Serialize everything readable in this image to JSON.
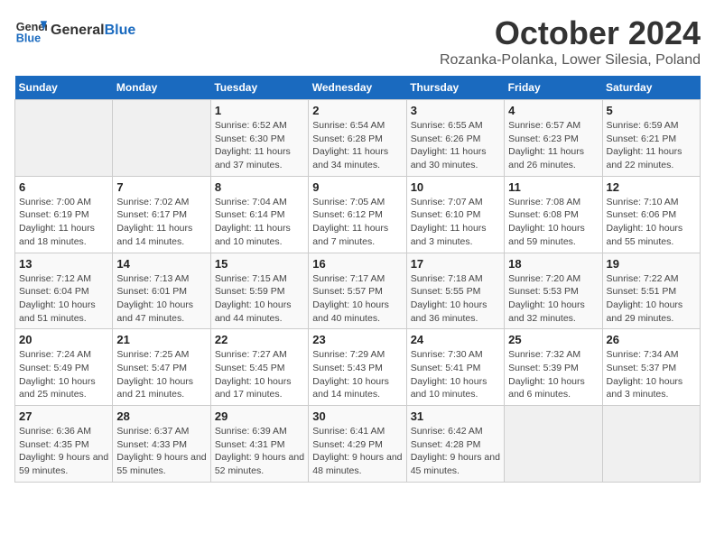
{
  "header": {
    "logo_line1": "General",
    "logo_line2": "Blue",
    "month": "October 2024",
    "location": "Rozanka-Polanka, Lower Silesia, Poland"
  },
  "weekdays": [
    "Sunday",
    "Monday",
    "Tuesday",
    "Wednesday",
    "Thursday",
    "Friday",
    "Saturday"
  ],
  "weeks": [
    [
      null,
      null,
      {
        "day": 1,
        "sunrise": "6:52 AM",
        "sunset": "6:30 PM",
        "daylight": "11 hours and 37 minutes."
      },
      {
        "day": 2,
        "sunrise": "6:54 AM",
        "sunset": "6:28 PM",
        "daylight": "11 hours and 34 minutes."
      },
      {
        "day": 3,
        "sunrise": "6:55 AM",
        "sunset": "6:26 PM",
        "daylight": "11 hours and 30 minutes."
      },
      {
        "day": 4,
        "sunrise": "6:57 AM",
        "sunset": "6:23 PM",
        "daylight": "11 hours and 26 minutes."
      },
      {
        "day": 5,
        "sunrise": "6:59 AM",
        "sunset": "6:21 PM",
        "daylight": "11 hours and 22 minutes."
      }
    ],
    [
      {
        "day": 6,
        "sunrise": "7:00 AM",
        "sunset": "6:19 PM",
        "daylight": "11 hours and 18 minutes."
      },
      {
        "day": 7,
        "sunrise": "7:02 AM",
        "sunset": "6:17 PM",
        "daylight": "11 hours and 14 minutes."
      },
      {
        "day": 8,
        "sunrise": "7:04 AM",
        "sunset": "6:14 PM",
        "daylight": "11 hours and 10 minutes."
      },
      {
        "day": 9,
        "sunrise": "7:05 AM",
        "sunset": "6:12 PM",
        "daylight": "11 hours and 7 minutes."
      },
      {
        "day": 10,
        "sunrise": "7:07 AM",
        "sunset": "6:10 PM",
        "daylight": "11 hours and 3 minutes."
      },
      {
        "day": 11,
        "sunrise": "7:08 AM",
        "sunset": "6:08 PM",
        "daylight": "10 hours and 59 minutes."
      },
      {
        "day": 12,
        "sunrise": "7:10 AM",
        "sunset": "6:06 PM",
        "daylight": "10 hours and 55 minutes."
      }
    ],
    [
      {
        "day": 13,
        "sunrise": "7:12 AM",
        "sunset": "6:04 PM",
        "daylight": "10 hours and 51 minutes."
      },
      {
        "day": 14,
        "sunrise": "7:13 AM",
        "sunset": "6:01 PM",
        "daylight": "10 hours and 47 minutes."
      },
      {
        "day": 15,
        "sunrise": "7:15 AM",
        "sunset": "5:59 PM",
        "daylight": "10 hours and 44 minutes."
      },
      {
        "day": 16,
        "sunrise": "7:17 AM",
        "sunset": "5:57 PM",
        "daylight": "10 hours and 40 minutes."
      },
      {
        "day": 17,
        "sunrise": "7:18 AM",
        "sunset": "5:55 PM",
        "daylight": "10 hours and 36 minutes."
      },
      {
        "day": 18,
        "sunrise": "7:20 AM",
        "sunset": "5:53 PM",
        "daylight": "10 hours and 32 minutes."
      },
      {
        "day": 19,
        "sunrise": "7:22 AM",
        "sunset": "5:51 PM",
        "daylight": "10 hours and 29 minutes."
      }
    ],
    [
      {
        "day": 20,
        "sunrise": "7:24 AM",
        "sunset": "5:49 PM",
        "daylight": "10 hours and 25 minutes."
      },
      {
        "day": 21,
        "sunrise": "7:25 AM",
        "sunset": "5:47 PM",
        "daylight": "10 hours and 21 minutes."
      },
      {
        "day": 22,
        "sunrise": "7:27 AM",
        "sunset": "5:45 PM",
        "daylight": "10 hours and 17 minutes."
      },
      {
        "day": 23,
        "sunrise": "7:29 AM",
        "sunset": "5:43 PM",
        "daylight": "10 hours and 14 minutes."
      },
      {
        "day": 24,
        "sunrise": "7:30 AM",
        "sunset": "5:41 PM",
        "daylight": "10 hours and 10 minutes."
      },
      {
        "day": 25,
        "sunrise": "7:32 AM",
        "sunset": "5:39 PM",
        "daylight": "10 hours and 6 minutes."
      },
      {
        "day": 26,
        "sunrise": "7:34 AM",
        "sunset": "5:37 PM",
        "daylight": "10 hours and 3 minutes."
      }
    ],
    [
      {
        "day": 27,
        "sunrise": "6:36 AM",
        "sunset": "4:35 PM",
        "daylight": "9 hours and 59 minutes."
      },
      {
        "day": 28,
        "sunrise": "6:37 AM",
        "sunset": "4:33 PM",
        "daylight": "9 hours and 55 minutes."
      },
      {
        "day": 29,
        "sunrise": "6:39 AM",
        "sunset": "4:31 PM",
        "daylight": "9 hours and 52 minutes."
      },
      {
        "day": 30,
        "sunrise": "6:41 AM",
        "sunset": "4:29 PM",
        "daylight": "9 hours and 48 minutes."
      },
      {
        "day": 31,
        "sunrise": "6:42 AM",
        "sunset": "4:28 PM",
        "daylight": "9 hours and 45 minutes."
      },
      null,
      null
    ]
  ],
  "labels": {
    "sunrise": "Sunrise:",
    "sunset": "Sunset:",
    "daylight": "Daylight:"
  }
}
